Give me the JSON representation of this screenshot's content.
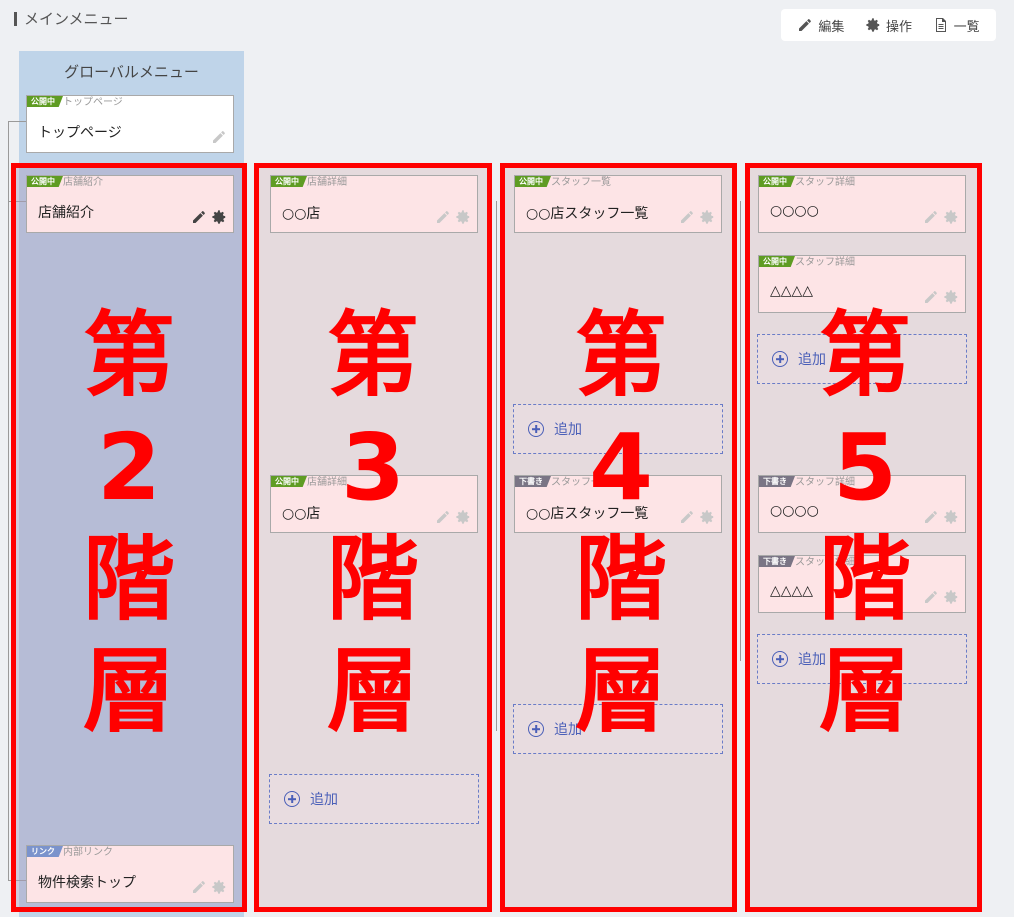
{
  "header": {
    "title": "メインメニュー"
  },
  "toolbar": {
    "edit": "編集",
    "operate": "操作",
    "list": "一覧"
  },
  "global_menu": {
    "title": "グローバルメニュー",
    "top_card": {
      "badge": "公開中",
      "type": "トップページ",
      "title": "トップページ"
    },
    "shop_card": {
      "badge": "公開中",
      "type": "店舗紹介",
      "title": "店舗紹介"
    },
    "link_card": {
      "badge": "リンク",
      "type": "内部リンク",
      "title": "物件検索トップ"
    }
  },
  "level3": {
    "cards": [
      {
        "badge": "公開中",
        "type": "店舗詳細",
        "title": "○○店"
      },
      {
        "badge": "公開中",
        "type": "店舗詳細",
        "title": "○○店"
      }
    ],
    "add": "追加"
  },
  "level4": {
    "cards": [
      {
        "badge": "公開中",
        "type": "スタッフ一覧",
        "title": "○○店スタッフ一覧"
      },
      {
        "badge": "下書き",
        "type": "スタッフ一覧",
        "title": "○○店スタッフ一覧"
      }
    ],
    "add1": "追加",
    "add2": "追加"
  },
  "level5": {
    "cards": [
      {
        "badge": "公開中",
        "type": "スタッフ詳細",
        "title": "○○○○"
      },
      {
        "badge": "公開中",
        "type": "スタッフ詳細",
        "title": "△△△△"
      },
      {
        "badge": "下書き",
        "type": "スタッフ詳細",
        "title": "○○○○"
      },
      {
        "badge": "下書き",
        "type": "スタッフ詳細",
        "title": "△△△△"
      }
    ],
    "add1": "追加",
    "add2": "追加"
  },
  "annotations": {
    "level2": [
      "第",
      "2",
      "階",
      "層"
    ],
    "level3": [
      "第",
      "3",
      "階",
      "層"
    ],
    "level4": [
      "第",
      "4",
      "階",
      "層"
    ],
    "level5": [
      "第",
      "5",
      "階",
      "層"
    ]
  },
  "colors": {
    "annotation_red": "#ff0000",
    "published_badge": "#5f9c23",
    "draft_badge": "#7a7585",
    "link_badge": "#7b93cc"
  }
}
